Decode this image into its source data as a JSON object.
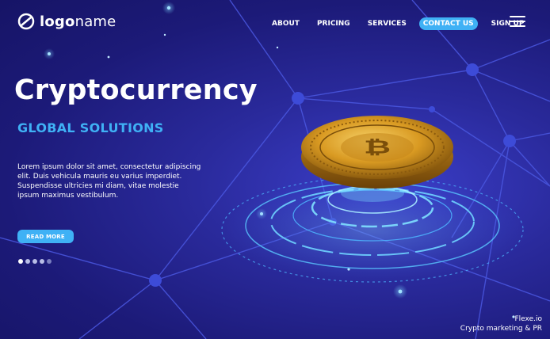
{
  "logo": {
    "bold": "logo",
    "light": "name"
  },
  "nav": {
    "items": [
      {
        "label": "ABOUT"
      },
      {
        "label": "PRICING"
      },
      {
        "label": "SERVICES"
      },
      {
        "label": "CONTACT US",
        "active": true
      },
      {
        "label": "SIGN UP"
      }
    ]
  },
  "hero": {
    "title": "Cryptocurrency",
    "subtitle": "GLOBAL SOLUTIONS",
    "body": "Lorem ipsum dolor sit amet, consectetur adipiscing elit. Duis vehicula mauris eu varius imperdiet. Suspendisse ultricies mi diam, vitae molestie ipsum maximus vestibulum.",
    "cta": "READ MORE"
  },
  "carousel": {
    "total": 5,
    "active_index": 0
  },
  "watermark": {
    "line1": "Flexe.io",
    "line2": "Crypto marketing & PR"
  },
  "colors": {
    "accent": "#3fb1f5",
    "background": "#1c1a78",
    "coin": "#e0a92a"
  },
  "icons": {
    "logo": "circle-slash-icon",
    "menu": "hamburger-icon",
    "coin": "bitcoin-icon"
  }
}
